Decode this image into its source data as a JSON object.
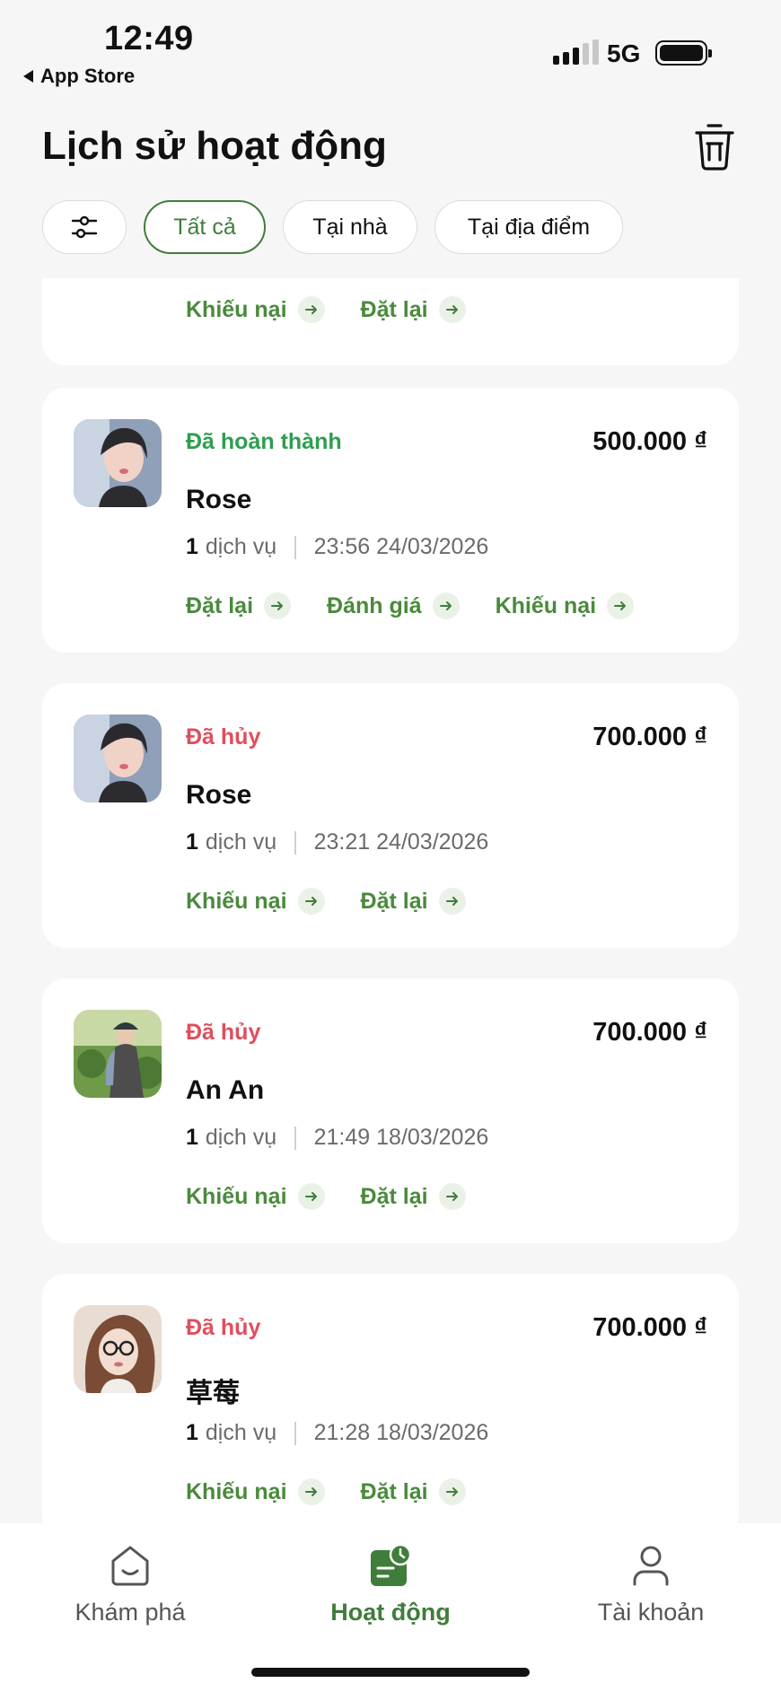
{
  "status_bar": {
    "time": "12:49",
    "back_app": "App Store",
    "network": "5G"
  },
  "header": {
    "title": "Lịch sử hoạt động",
    "trash_icon": "trash-icon"
  },
  "filters": {
    "filter_icon": "sliders-icon",
    "chips": [
      "Tất cả",
      "Tại nhà",
      "Tại địa điểm"
    ],
    "active": "Tất cả"
  },
  "partial_card": {
    "actions": [
      "Khiếu nại",
      "Đặt lại"
    ]
  },
  "bookings": [
    {
      "status": "Đã hoàn thành",
      "status_type": "done",
      "price": "500.000 ₫",
      "name": "Rose",
      "service_count": "1",
      "service_label": "dịch vụ",
      "datetime": "23:56 24/03/2026",
      "actions": [
        "Đặt lại",
        "Đánh giá",
        "Khiếu nại"
      ]
    },
    {
      "status": "Đã hủy",
      "status_type": "cancel",
      "price": "700.000 ₫",
      "name": "Rose",
      "service_count": "1",
      "service_label": "dịch vụ",
      "datetime": "23:21 24/03/2026",
      "actions": [
        "Khiếu nại",
        "Đặt lại"
      ]
    },
    {
      "status": "Đã hủy",
      "status_type": "cancel",
      "price": "700.000 ₫",
      "name": "An An",
      "service_count": "1",
      "service_label": "dịch vụ",
      "datetime": "21:49 18/03/2026",
      "actions": [
        "Khiếu nại",
        "Đặt lại"
      ]
    },
    {
      "status": "Đã hủy",
      "status_type": "cancel",
      "price": "700.000 ₫",
      "name": "草莓",
      "service_count": "1",
      "service_label": "dịch vụ",
      "datetime": "21:28 18/03/2026",
      "actions": [
        "Khiếu nại",
        "Đặt lại"
      ]
    }
  ],
  "bottom_nav": {
    "items": [
      {
        "label": "Khám phá",
        "icon": "home-icon"
      },
      {
        "label": "Hoạt động",
        "icon": "activity-icon"
      },
      {
        "label": "Tài khoản",
        "icon": "user-icon"
      }
    ],
    "active": "Hoạt động"
  },
  "colors": {
    "accent": "#3f7d3b",
    "done": "#2e9e4f",
    "cancel": "#e04e5e",
    "action": "#4a8a3c"
  }
}
